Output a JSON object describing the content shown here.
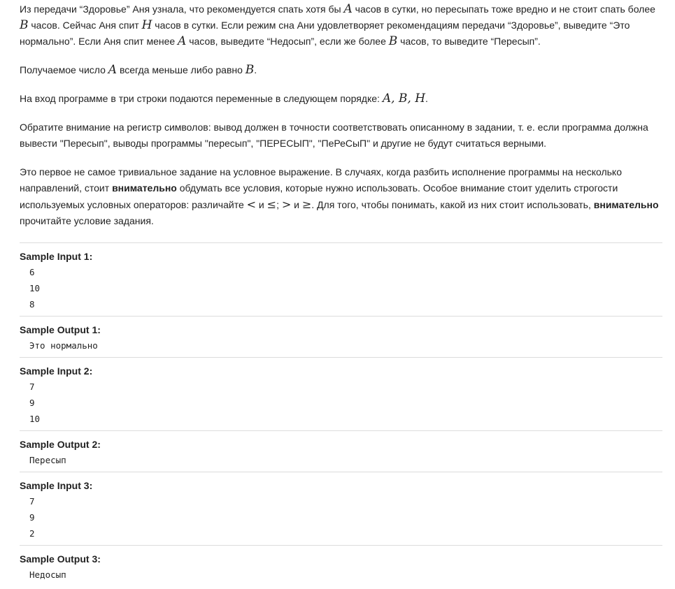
{
  "problem": {
    "p1": [
      "Из передачи “Здоровье” Аня узнала, что рекомендуется спать хотя бы ",
      "A",
      " часов в сутки, но пересыпать тоже вредно и не стоит спать более ",
      "B",
      " часов. Сейчас Аня спит ",
      "H",
      " часов в сутки. Если режим сна Ани удовлетворяет рекомендациям передачи “Здоровье”, выведите “Это нормально”. Если Аня спит менее ",
      "A",
      " часов, выведите “Недосып”, если же более ",
      "B",
      " часов, то выведите “Пересып”."
    ],
    "p2": [
      "Получаемое число ",
      "A",
      " всегда меньше либо равно ",
      "B",
      "."
    ],
    "p3": [
      "На вход программе в три строки подаются переменные в следующем порядке: ",
      "A, B, H",
      "."
    ],
    "p4": "Обратите внимание на регистр символов: вывод должен в точности соответствовать описанному в задании, т. е. если программа должна вывести \"Пересып\", выводы программы \"пересып\", \"ПЕРЕСЫП\", \"ПеРеСыП\" и другие не будут считаться верными.",
    "p5": [
      "Это первое не самое тривиальное задание на условное выражение. В случаях, когда разбить исполнение программы на несколько направлений, стоит ",
      "внимательно",
      " обдумать все условия, которые нужно использовать. Особое внимание стоит уделить строгости используемых условных операторов: различайте ",
      "<",
      " и ",
      "≤",
      "; ",
      ">",
      " и ",
      "≥",
      ". Для того, чтобы понимать, какой из них стоит использовать, ",
      "внимательно",
      " прочитайте условие задания."
    ]
  },
  "samples": [
    {
      "title": "Sample Input 1:",
      "lines": [
        "6",
        "10",
        "8"
      ]
    },
    {
      "title": "Sample Output 1:",
      "lines": [
        "Это нормально"
      ]
    },
    {
      "title": "Sample Input 2:",
      "lines": [
        "7",
        "9",
        "10"
      ]
    },
    {
      "title": "Sample Output 2:",
      "lines": [
        "Пересып"
      ]
    },
    {
      "title": "Sample Input 3:",
      "lines": [
        "7",
        "9",
        "2"
      ]
    },
    {
      "title": "Sample Output 3:",
      "lines": [
        "Недосып"
      ]
    }
  ]
}
